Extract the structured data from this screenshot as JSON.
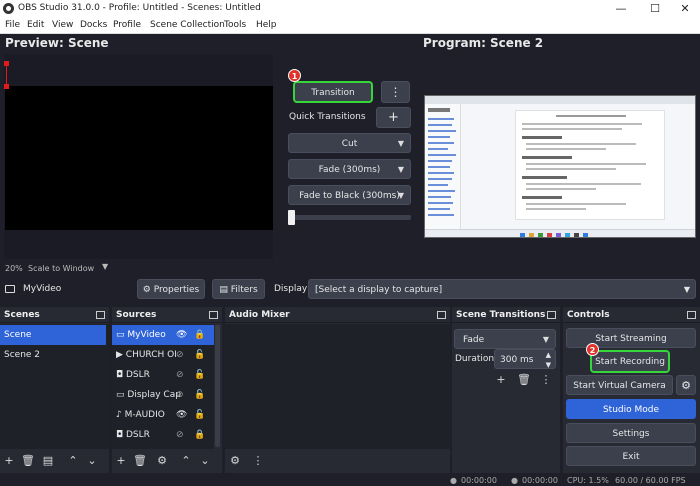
{
  "window": {
    "title": "OBS Studio 31.0.0 - Profile: Untitled - Scenes: Untitled",
    "minimize": "—",
    "maximize": "☐",
    "close": "✕"
  },
  "menu": [
    "File",
    "Edit",
    "View",
    "Docks",
    "Profile",
    "Scene Collection",
    "Tools",
    "Help"
  ],
  "preview": {
    "title": "Preview: Scene",
    "zoom": "20%",
    "zoom_mode": "Scale to Window"
  },
  "program": {
    "title": "Program: Scene 2"
  },
  "transitions_panel": {
    "transition_button": "Transition",
    "badge_1": "1",
    "menu_button": "⋮",
    "quick_transitions_label": "Quick Transitions",
    "add_button": "+",
    "items": [
      "Cut",
      "Fade (300ms)",
      "Fade to Black (300ms)"
    ]
  },
  "source_bar": {
    "current_source": "MyVideo",
    "properties": "Properties",
    "filters": "Filters",
    "display_label": "Display",
    "display_value": "[Select a display to capture]"
  },
  "scenes": {
    "title": "Scenes",
    "items": [
      "Scene",
      "Scene 2"
    ],
    "selected": "Scene"
  },
  "sources": {
    "title": "Sources",
    "items": [
      "MyVideo",
      "CHURCH OI",
      "DSLR",
      "Display Cap",
      "M-AUDIO",
      "DSLR"
    ]
  },
  "audio_mixer": {
    "title": "Audio Mixer"
  },
  "scene_transitions": {
    "title": "Scene Transitions",
    "transition": "Fade",
    "duration_label": "Duration",
    "duration_value": "300 ms"
  },
  "controls": {
    "title": "Controls",
    "start_streaming": "Start Streaming",
    "start_recording": "Start Recording",
    "badge_2": "2",
    "start_virtual_camera": "Start Virtual Camera",
    "studio_mode": "Studio Mode",
    "settings": "Settings",
    "exit": "Exit"
  },
  "status": {
    "stream_time": "00:00:00",
    "rec_time": "00:00:00",
    "cpu": "CPU: 1.5%",
    "fps": "60.00 / 60.00 FPS"
  },
  "colors": {
    "accent_blue": "#2f63d8",
    "highlight_green": "#34d63a",
    "badge_red": "#e0312a"
  }
}
